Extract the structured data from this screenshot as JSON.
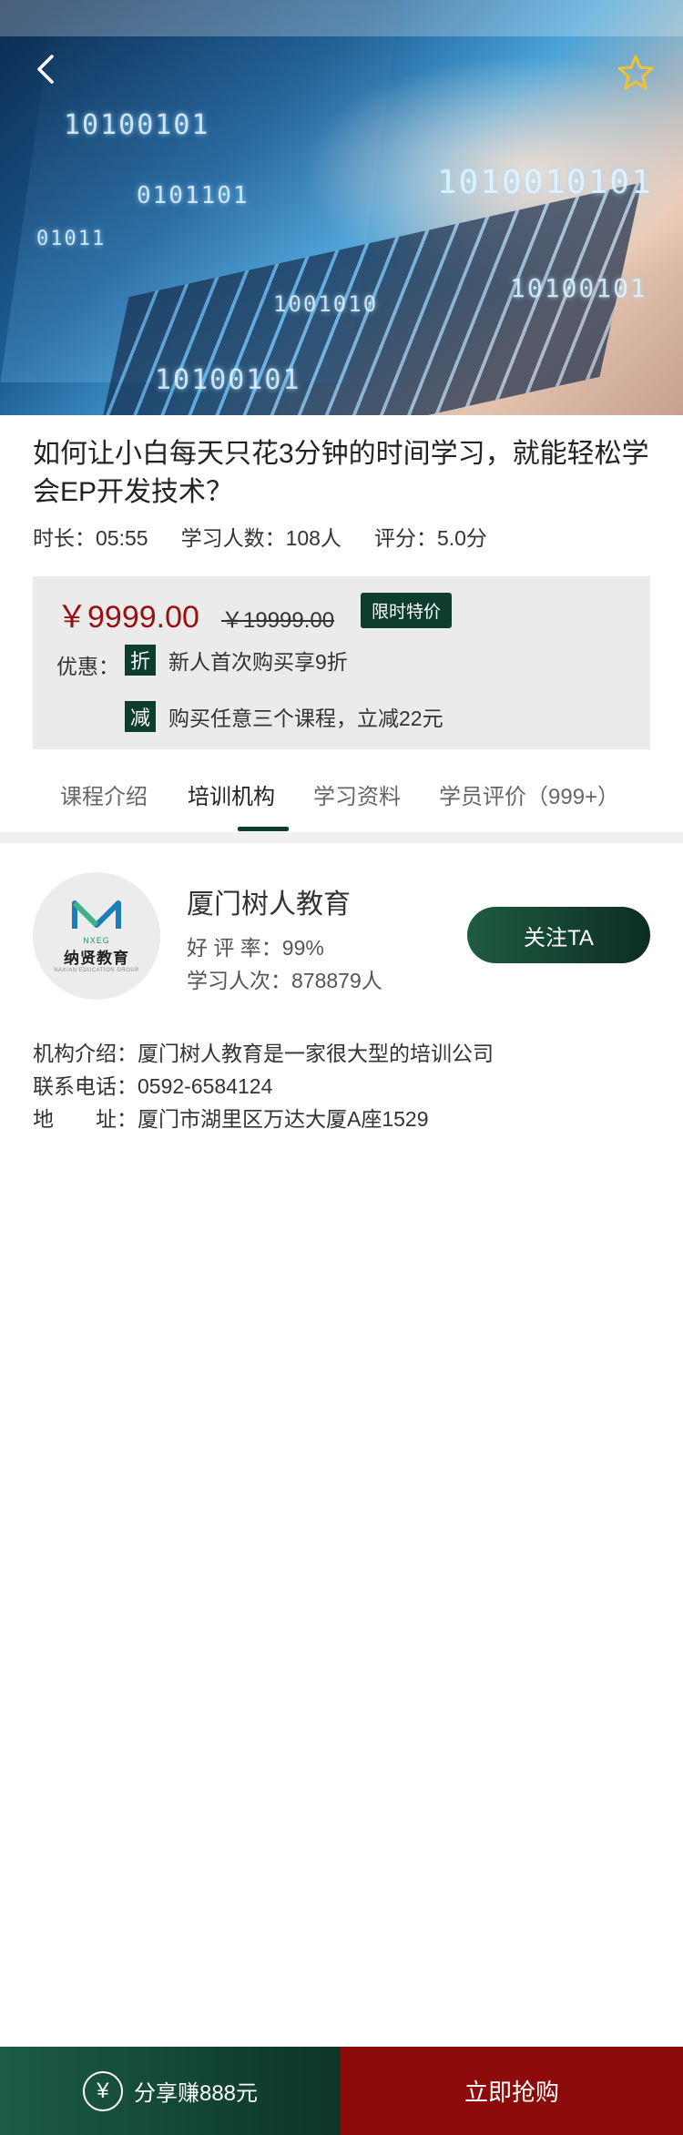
{
  "course": {
    "title": "如何让小白每天只花3分钟的时间学习，就能轻松学会EP开发技术？",
    "duration": "时长：05:55",
    "learners": "学习人数：108人",
    "rating": "评分：5.0分"
  },
  "pricing": {
    "price": "￥9999.00",
    "original_price": "￥19999.00",
    "tag": "限时特价",
    "promo_label": "优惠：",
    "promos": [
      {
        "badge": "折",
        "text": "新人首次购买享9折"
      },
      {
        "badge": "减",
        "text": "购买任意三个课程，立减22元"
      }
    ]
  },
  "tabs": [
    {
      "label": "课程介绍"
    },
    {
      "label": "培训机构"
    },
    {
      "label": "学习资料"
    },
    {
      "label": "学员评价（999+）"
    }
  ],
  "active_tab": "培训机构",
  "institution": {
    "logo_en": "NXEG",
    "logo_cn": "纳贤教育",
    "logo_sub": "NAXIAN EDUCATION GROUP",
    "name": "厦门树人教育",
    "praise_rate": "好 评 率：99%",
    "study_count": "学习人次：878879人",
    "follow_label": "关注TA",
    "intro": "机构介绍：厦门树人教育是一家很大型的培训公司",
    "phone": "联系电话：0592-6584124",
    "address_label": "地　　址：",
    "address": "厦门市湖里区万达大厦A座1529"
  },
  "hero_digits": [
    "10100101",
    "0101101",
    "1010010101",
    "10100101",
    "1001010",
    "10100101",
    "01011"
  ],
  "icons": {
    "back": "back-arrow-icon",
    "favorite": "star-icon",
    "share": "yen-icon"
  },
  "colors": {
    "accent": "#0c3d2e",
    "price": "#9a1010",
    "buy": "#8e0b0b"
  },
  "bottom": {
    "share_label": "分享赚888元",
    "buy_label": "立即抢购"
  }
}
